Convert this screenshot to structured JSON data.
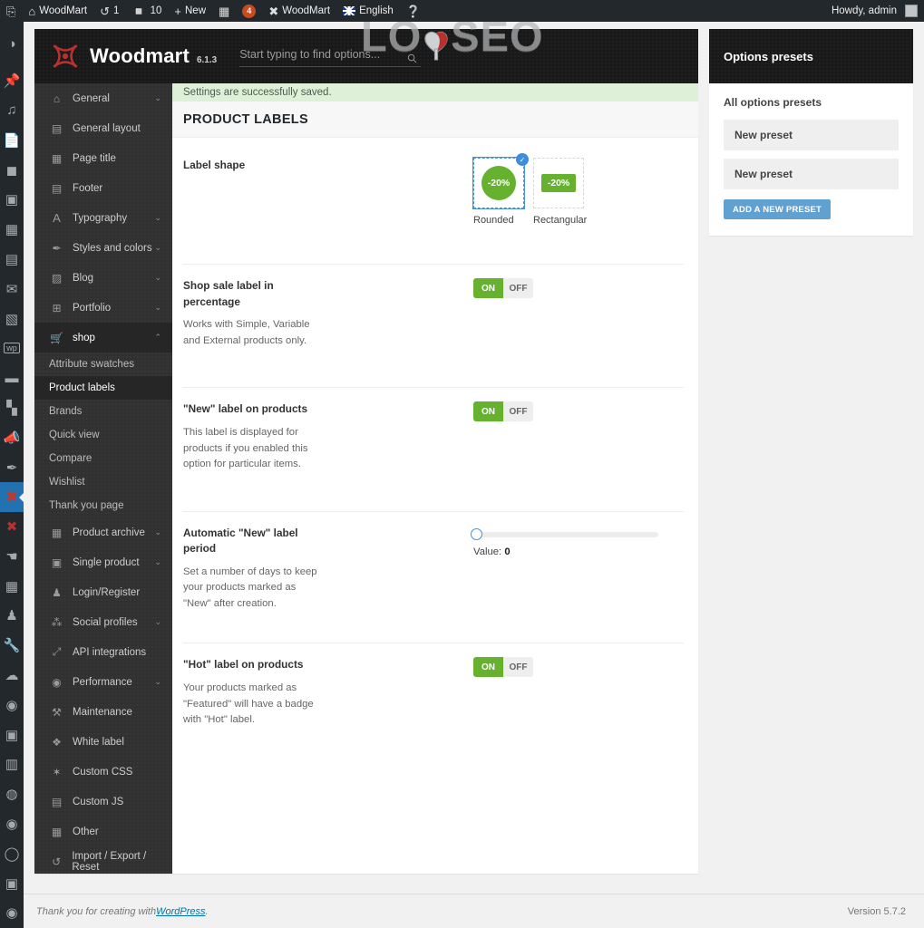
{
  "adminbar": {
    "wp_logo_icon": "wordpress-logo-icon",
    "items": [
      {
        "icon": "home-icon",
        "label": "WoodMart",
        "name": "adminbar-site-name"
      },
      {
        "icon": "update-icon",
        "label": "1",
        "name": "adminbar-updates"
      },
      {
        "icon": "comment-icon",
        "label": "10",
        "name": "adminbar-comments"
      },
      {
        "icon": "plus-icon",
        "label": "New",
        "name": "adminbar-new-content"
      },
      {
        "icon": "wpbakery-icon",
        "label": "",
        "name": "adminbar-wpbakery"
      },
      {
        "icon": "badge-icon",
        "label": "4",
        "name": "adminbar-notification-badge"
      },
      {
        "icon": "woodmart-icon",
        "label": "WoodMart",
        "name": "adminbar-woodmart"
      },
      {
        "icon": "flag-gb-icon",
        "label": "English",
        "name": "adminbar-language"
      },
      {
        "icon": "help-icon",
        "label": "",
        "name": "adminbar-help"
      }
    ],
    "howdy": "Howdy, admin"
  },
  "rail": {
    "items": [
      {
        "name": "rail-dashboard",
        "icon": "dashboard-icon",
        "glyph": "◉"
      },
      {
        "name": "rail-posts",
        "icon": "pin-icon",
        "glyph": "✎"
      },
      {
        "name": "rail-media",
        "icon": "media-icon",
        "glyph": "♫"
      },
      {
        "name": "rail-pages",
        "icon": "pages-icon",
        "glyph": "▤"
      },
      {
        "name": "rail-comments",
        "icon": "comment-icon",
        "glyph": "💬"
      },
      {
        "name": "rail-portfolio",
        "icon": "portfolio-icon",
        "glyph": "▣"
      },
      {
        "name": "rail-slider",
        "icon": "slider-icon",
        "glyph": "▦"
      },
      {
        "name": "rail-templates",
        "icon": "templates-icon",
        "glyph": "▤"
      },
      {
        "name": "rail-mail",
        "icon": "envelope-icon",
        "glyph": "✉"
      },
      {
        "name": "rail-gallery",
        "icon": "image-icon",
        "glyph": "🖼"
      },
      {
        "name": "rail-wpbakery",
        "icon": "wpbakery-icon",
        "glyph": "▥"
      },
      {
        "name": "rail-archive",
        "icon": "archive-icon",
        "glyph": "▬"
      },
      {
        "name": "rail-analytics",
        "icon": "bar-chart-icon",
        "glyph": "▮"
      },
      {
        "name": "rail-marketing",
        "icon": "megaphone-icon",
        "glyph": "📢"
      },
      {
        "name": "rail-appearance",
        "icon": "paintbrush-icon",
        "glyph": "✒"
      },
      {
        "name": "rail-woodmart",
        "icon": "woodmart-icon",
        "glyph": "✖",
        "active": true
      },
      {
        "name": "rail-woodmart-2",
        "icon": "woodmart-icon",
        "glyph": "✖"
      },
      {
        "name": "rail-plugins",
        "icon": "plug-icon",
        "glyph": "⚡"
      },
      {
        "name": "rail-forms",
        "icon": "form-icon",
        "glyph": "▦"
      },
      {
        "name": "rail-users",
        "icon": "user-icon",
        "glyph": "👤"
      },
      {
        "name": "rail-tools",
        "icon": "wrench-icon",
        "glyph": "🔧"
      },
      {
        "name": "rail-cloud",
        "icon": "cloud-icon",
        "glyph": "☁"
      },
      {
        "name": "rail-performance",
        "icon": "speedometer-icon",
        "glyph": "◑"
      },
      {
        "name": "rail-contacts",
        "icon": "contact-icon",
        "glyph": "▤"
      },
      {
        "name": "rail-forms-2",
        "icon": "clipboard-icon",
        "glyph": "▥"
      },
      {
        "name": "rail-seo",
        "icon": "seo-icon",
        "glyph": "◍"
      },
      {
        "name": "rail-views",
        "icon": "eye-icon",
        "glyph": "◉"
      },
      {
        "name": "rail-search",
        "icon": "search-icon",
        "glyph": "○"
      },
      {
        "name": "rail-duplicate",
        "icon": "copy-icon",
        "glyph": "▣"
      },
      {
        "name": "rail-collapse",
        "icon": "collapse-icon",
        "glyph": "◀"
      }
    ]
  },
  "redux": {
    "brand": "Woodmart",
    "version": "6.1.3",
    "search_placeholder": "Start typing to find options...",
    "watermark": "LOYSEO",
    "watermark_left": "LO",
    "watermark_right": "SEO",
    "notice": "Settings are successfully saved.",
    "section_title": "PRODUCT LABELS"
  },
  "sidebar": {
    "groups": [
      {
        "label": "General",
        "icon": "home-icon",
        "glyph": "⌂",
        "caret": "⌄"
      },
      {
        "label": "General layout",
        "icon": "layout-icon",
        "glyph": "▤",
        "caret": ""
      },
      {
        "label": "Page title",
        "icon": "page-title-icon",
        "glyph": "▦",
        "caret": ""
      },
      {
        "label": "Footer",
        "icon": "footer-icon",
        "glyph": "▤",
        "caret": ""
      },
      {
        "label": "Typography",
        "icon": "typography-icon",
        "glyph": "A",
        "caret": "⌄"
      },
      {
        "label": "Styles and colors",
        "icon": "brush-icon",
        "glyph": "✎",
        "caret": "⌄"
      },
      {
        "label": "Blog",
        "icon": "blog-icon",
        "glyph": "▨",
        "caret": "⌄"
      },
      {
        "label": "Portfolio",
        "icon": "grid-icon",
        "glyph": "⊞",
        "caret": "⌄"
      }
    ],
    "shop": {
      "label": "shop",
      "icon": "cart-icon",
      "glyph": "🛒",
      "caret": "⌃"
    },
    "shop_children": [
      {
        "label": "Attribute swatches",
        "active": false
      },
      {
        "label": "Product labels",
        "active": true
      },
      {
        "label": "Brands",
        "active": false
      },
      {
        "label": "Quick view",
        "active": false
      },
      {
        "label": "Compare",
        "active": false
      },
      {
        "label": "Wishlist",
        "active": false
      },
      {
        "label": "Thank you page",
        "active": false
      }
    ],
    "groups_after": [
      {
        "label": "Product archive",
        "icon": "shop-archive-icon",
        "glyph": "▥",
        "caret": "⌄"
      },
      {
        "label": "Single product",
        "icon": "product-icon",
        "glyph": "▣",
        "caret": "⌄"
      },
      {
        "label": "Login/Register",
        "icon": "user-icon",
        "glyph": "☗",
        "caret": ""
      },
      {
        "label": "Social profiles",
        "icon": "share-icon",
        "glyph": "⁂",
        "caret": "⌄"
      },
      {
        "label": "API integrations",
        "icon": "api-icon",
        "glyph": "⤢",
        "caret": ""
      },
      {
        "label": "Performance",
        "icon": "speed-icon",
        "glyph": "◑",
        "caret": "⌄"
      },
      {
        "label": "Maintenance",
        "icon": "hammer-icon",
        "glyph": "⚒",
        "caret": ""
      },
      {
        "label": "White label",
        "icon": "tag-icon",
        "glyph": "🏷",
        "caret": ""
      },
      {
        "label": "Custom CSS",
        "icon": "css-icon",
        "glyph": "✦",
        "caret": ""
      },
      {
        "label": "Custom JS",
        "icon": "js-icon",
        "glyph": "▤",
        "caret": ""
      },
      {
        "label": "Other",
        "icon": "other-icon",
        "glyph": "▦",
        "caret": ""
      },
      {
        "label": "Import / Export / Reset",
        "icon": "reset-icon",
        "glyph": "↺",
        "caret": ""
      }
    ]
  },
  "fields": {
    "label_shape": {
      "title": "Label shape",
      "options": [
        {
          "caption": "Rounded",
          "badge": "-20%",
          "shape": "round",
          "selected": true
        },
        {
          "caption": "Rectangular",
          "badge": "-20%",
          "shape": "rect",
          "selected": false
        }
      ]
    },
    "sale_percentage": {
      "title": "Shop sale label in percentage",
      "desc": "Works with Simple, Variable and External products only.",
      "on": "ON",
      "off": "OFF",
      "value": "on"
    },
    "new_label": {
      "title": "\"New\" label on products",
      "desc": "This label is displayed for products if you enabled this option for particular items.",
      "on": "ON",
      "off": "OFF",
      "value": "on"
    },
    "new_period": {
      "title": "Automatic \"New\" label period",
      "desc": "Set a number of days to keep your products marked as \"New\" after creation.",
      "value_label": "Value:",
      "value": "0",
      "slider_percent": 0
    },
    "hot_label": {
      "title": "\"Hot\" label on products",
      "desc": "Your products marked as \"Featured\" will have a badge with \"Hot\" label.",
      "on": "ON",
      "off": "OFF",
      "value": "on"
    }
  },
  "presets": {
    "title": "Options presets",
    "subtitle": "All options presets",
    "items": [
      {
        "label": "New preset"
      },
      {
        "label": "New preset"
      }
    ],
    "add_button": "ADD A NEW PRESET"
  },
  "footer": {
    "thanks_prefix": "Thank you for creating with ",
    "link": "WordPress",
    "thanks_suffix": ".",
    "version": "Version 5.7.2"
  },
  "colors": {
    "admin_dark": "#23282d",
    "redux_header": "#191919",
    "sidebar": "#313131",
    "accent_green": "#66b22e",
    "accent_blue": "#4a90d9",
    "preset_button": "#61a1d1",
    "notice_bg": "#dff0d8",
    "woodmart_red": "#b8312f"
  }
}
